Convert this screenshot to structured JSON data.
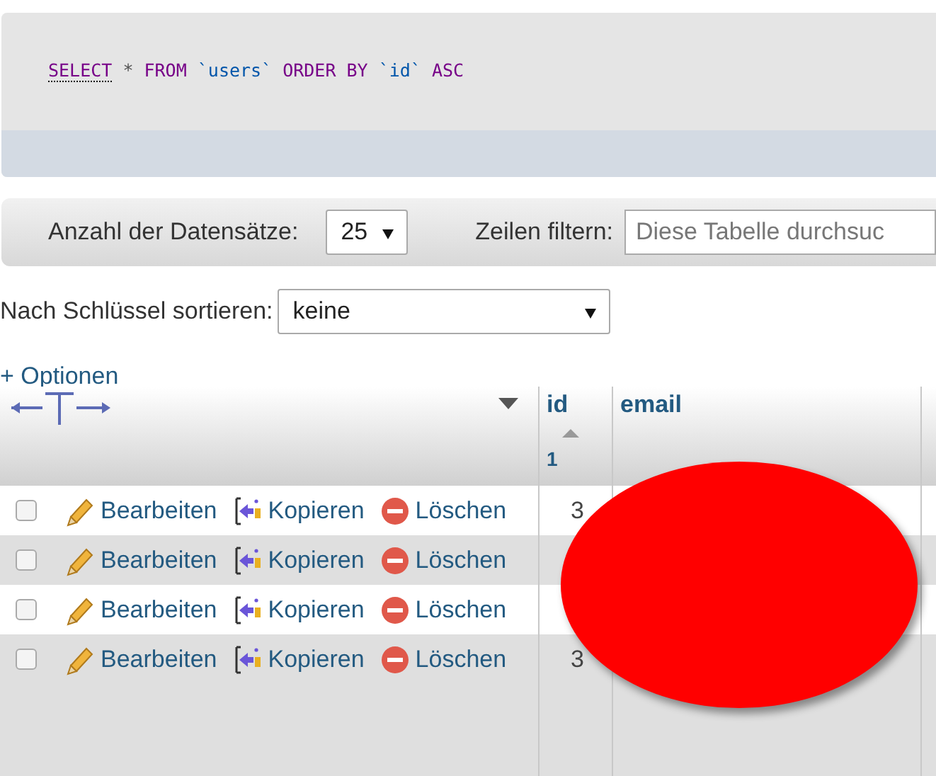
{
  "query": {
    "parts": [
      {
        "text": "SELECT",
        "kind": "keyword",
        "underlined": true
      },
      {
        "text": "*",
        "kind": "plain"
      },
      {
        "text": "FROM",
        "kind": "keyword"
      },
      {
        "text": "`users`",
        "kind": "name"
      },
      {
        "text": "ORDER BY",
        "kind": "keyword"
      },
      {
        "text": "`id`",
        "kind": "name"
      },
      {
        "text": "ASC",
        "kind": "keyword"
      }
    ]
  },
  "toolbar": {
    "rows_label": "Anzahl der Datensätze:",
    "rows_value": "25",
    "filter_label": "Zeilen filtern:",
    "filter_placeholder": "Diese Tabelle durchsuc"
  },
  "sort": {
    "label": "Nach Schlüssel sortieren:",
    "value": "keine"
  },
  "options_link": "+ Optionen",
  "table": {
    "columns": [
      {
        "label": "id",
        "sort_number": "1"
      },
      {
        "label": "email"
      },
      {}
    ],
    "rows": [
      {
        "checked": false,
        "edit": "Bearbeiten",
        "copy": "Kopieren",
        "delete": "Löschen",
        "id": "3"
      },
      {
        "checked": false,
        "edit": "Bearbeiten",
        "copy": "Kopieren",
        "delete": "Löschen"
      },
      {
        "checked": false,
        "edit": "Bearbeiten",
        "copy": "Kopieren",
        "delete": "Löschen"
      },
      {
        "checked": false,
        "edit": "Bearbeiten",
        "copy": "Kopieren",
        "delete": "Löschen",
        "id": "3"
      }
    ]
  }
}
